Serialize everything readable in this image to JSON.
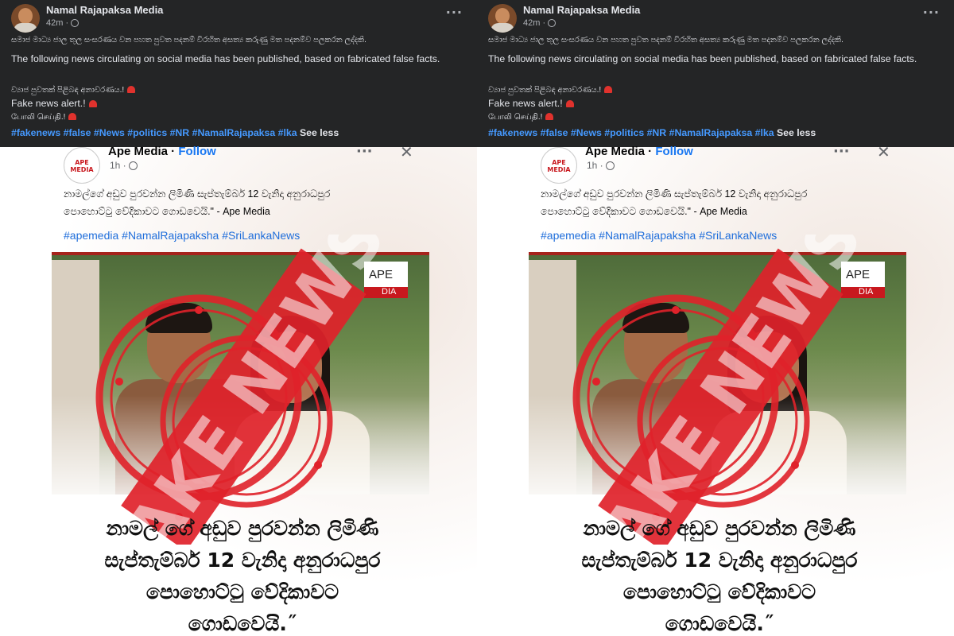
{
  "post": {
    "page_name": "Namal Rajapaksa Media",
    "time": "42m ·",
    "menu_icon": "···",
    "line_sinhala": "සමාජ මාධ්‍ය ජාල තුල සංසරණය වන පහත පුවත පදනම් විරහිත අසත්‍ය කරුණු මත පදනම්ව පලකරන ලද්දකි.",
    "line_english": "The following news circulating on social media has been published, based on fabricated false facts.",
    "alert_sinhala": "ව්‍යාජ පුවතක් පිළිබඳ අනාවරණය.!",
    "alert_english": "Fake news alert.!",
    "alert_tamil": "போலி செய்தி.!",
    "hashtags": "#fakenews #false #News #politics #NR #NamalRajapaksa #lka",
    "see_less": "See less"
  },
  "shared": {
    "logo_text": "APE MEDIA",
    "name": "Ape Media",
    "follow_sep": " · ",
    "follow": "Follow",
    "time": "1h ·",
    "menu_icon": "···",
    "close_icon": "✕",
    "caption": "නාමල්ගේ අඩුව පුරවන්න ලිමිණි සැප්තැම්බර් 12 වැනිදා අනුරාධපුර පොහොට්ටු වේදිකාවට ගොඩවෙයි.\" - Ape Media",
    "tags": "#apemedia #NamalRajapaksha #SriLankaNews",
    "badge_top": "APE",
    "badge_bottom": "DIA",
    "stamp_text": "FAKE NEWS",
    "headline_l1": "නාමල් ගේ අඩුව පුරවන්න ලිමිණි",
    "headline_l2": "සැප්තැම්බර් 12 වැනිදා අනුරාධපුර",
    "headline_l3": "පොහොට්ටු වේදිකාවට",
    "headline_l4": "ගොඩවෙයි.˝"
  },
  "colors": {
    "dark_bg": "#242526",
    "hashtag_blue": "#4599ff",
    "stamp_red": "#e0222a",
    "follow_blue": "#1877f2"
  }
}
